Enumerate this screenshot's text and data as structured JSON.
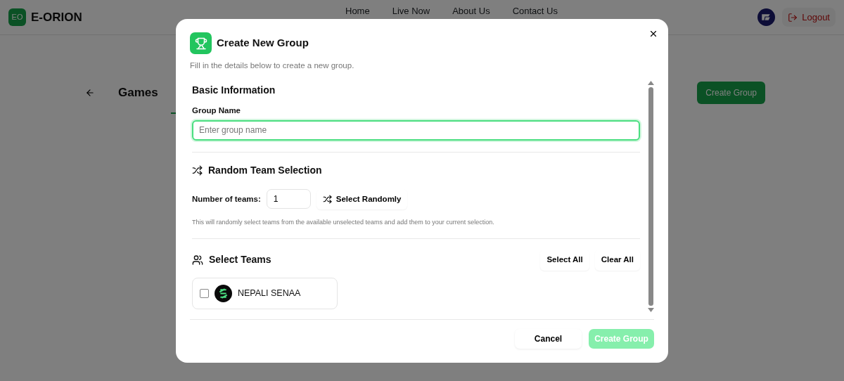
{
  "navbar": {
    "logo_initials": "EO",
    "brand": "E-ORION",
    "links": [
      "Home",
      "Live Now",
      "About Us",
      "Contact Us"
    ],
    "logout": "Logout"
  },
  "page": {
    "title": "Games",
    "create_button": "Create Group"
  },
  "modal": {
    "title": "Create New Group",
    "subtitle": "Fill in the details below to create a new group.",
    "basic": {
      "heading": "Basic Information",
      "label": "Group Name",
      "placeholder": "Enter group name"
    },
    "random": {
      "heading": "Random Team Selection",
      "label": "Number of teams:",
      "value": "1",
      "button": "Select Randomly",
      "note": "This will randomly select teams from the available unselected teams and add them to your current selection."
    },
    "teams": {
      "heading": "Select Teams",
      "select_all": "Select All",
      "clear_all": "Clear All",
      "items": [
        {
          "name": "NEPALI SENAA",
          "checked": false
        }
      ]
    },
    "footer": {
      "cancel": "Cancel",
      "submit": "Create Group",
      "submit_disabled": true
    }
  }
}
